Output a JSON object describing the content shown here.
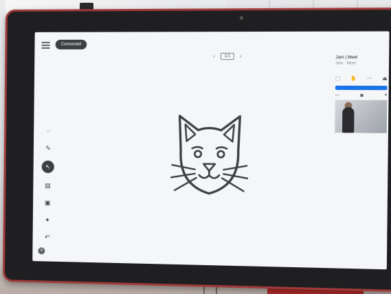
{
  "screen": {
    "status_pill": "Connected",
    "pager_label": "1/1",
    "pager_prev": "‹",
    "pager_next": "›"
  },
  "toolbar": {
    "tools": [
      {
        "name": "shapes",
        "glyph": "◌"
      },
      {
        "name": "pen",
        "glyph": "✎"
      },
      {
        "name": "select",
        "glyph": "↖",
        "active": true
      },
      {
        "name": "sticky-note",
        "glyph": "▤"
      },
      {
        "name": "image",
        "glyph": "▣"
      },
      {
        "name": "laser",
        "glyph": "✦"
      },
      {
        "name": "undo",
        "glyph": "↶"
      }
    ]
  },
  "panel": {
    "title": "Jam | Meet",
    "subtitle": "Jam · Meet",
    "banner_text": "",
    "controls": [
      "⬚",
      "✋",
      "⋯",
      "⏏"
    ]
  },
  "bottom": {
    "close_glyph": "×",
    "label": ""
  },
  "colors": {
    "bezel": "#1f1f21",
    "frame_trim": "#a03a3a",
    "canvas": "#f5f6f8",
    "banner": "#1a73e8"
  }
}
